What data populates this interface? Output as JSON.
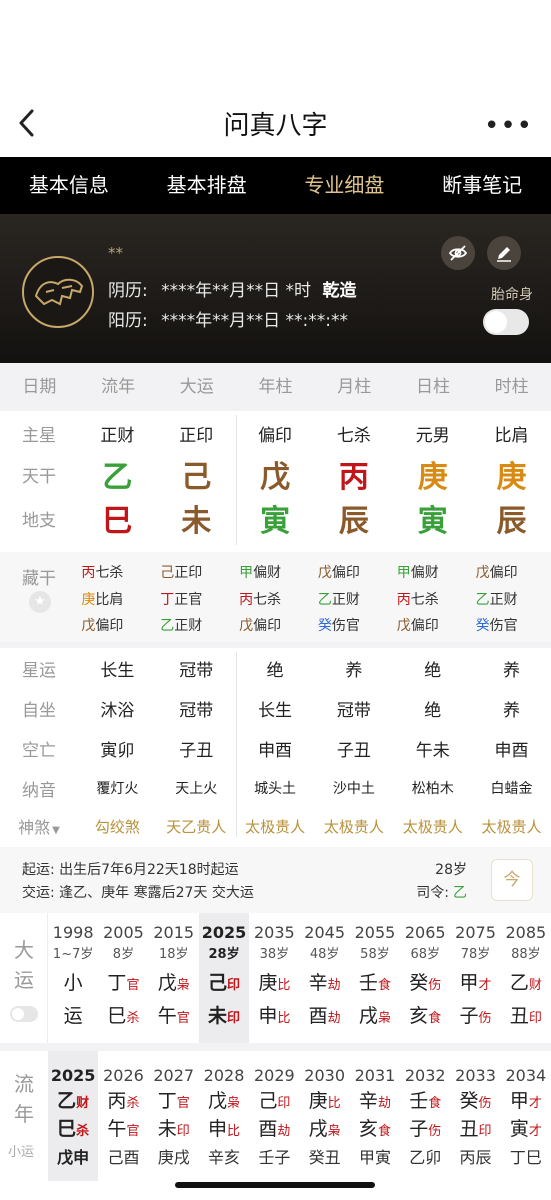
{
  "header": {
    "title": "问真八字"
  },
  "tabs": [
    "基本信息",
    "基本排盘",
    "专业细盘",
    "断事笔记"
  ],
  "banner": {
    "name": "**",
    "lunar_label": "阴历:",
    "lunar_value": "****年**月**日 *时",
    "gender": "乾造",
    "solar_label": "阳历:",
    "solar_value": "****年**月**日 **:**:**",
    "taimingshen": "胎命身"
  },
  "columns": [
    "日期",
    "流年",
    "大运",
    "年柱",
    "月柱",
    "日柱",
    "时柱"
  ],
  "rows": {
    "zhuxing": {
      "label": "主星",
      "values": [
        "正财",
        "正印",
        "偏印",
        "七杀",
        "元男",
        "比肩"
      ]
    },
    "tiangan": {
      "label": "天干",
      "values": [
        "乙",
        "己",
        "戊",
        "丙",
        "庚",
        "庚"
      ],
      "colors": [
        "#3aa03a",
        "#8a5a2b",
        "#8a5a2b",
        "#c0161a",
        "#d98a12",
        "#d98a12"
      ]
    },
    "dizhi": {
      "label": "地支",
      "values": [
        "巳",
        "未",
        "寅",
        "辰",
        "寅",
        "辰"
      ],
      "colors": [
        "#c0161a",
        "#8a5a2b",
        "#3aa03a",
        "#8a5a2b",
        "#3aa03a",
        "#8a5a2b"
      ]
    }
  },
  "canggan": {
    "label": "藏干",
    "cols": [
      [
        {
          "g": "丙",
          "c": "#c0161a",
          "t": "七杀"
        },
        {
          "g": "庚",
          "c": "#d98a12",
          "t": "比肩"
        },
        {
          "g": "戊",
          "c": "#8a5a2b",
          "t": "偏印"
        }
      ],
      [
        {
          "g": "己",
          "c": "#8a5a2b",
          "t": "正印"
        },
        {
          "g": "丁",
          "c": "#c0161a",
          "t": "正官"
        },
        {
          "g": "乙",
          "c": "#3aa03a",
          "t": "正财"
        }
      ],
      [
        {
          "g": "甲",
          "c": "#3aa03a",
          "t": "偏财"
        },
        {
          "g": "丙",
          "c": "#c0161a",
          "t": "七杀"
        },
        {
          "g": "戊",
          "c": "#8a5a2b",
          "t": "偏印"
        }
      ],
      [
        {
          "g": "戊",
          "c": "#8a5a2b",
          "t": "偏印"
        },
        {
          "g": "乙",
          "c": "#3aa03a",
          "t": "正财"
        },
        {
          "g": "癸",
          "c": "#2a6bd6",
          "t": "伤官"
        }
      ],
      [
        {
          "g": "甲",
          "c": "#3aa03a",
          "t": "偏财"
        },
        {
          "g": "丙",
          "c": "#c0161a",
          "t": "七杀"
        },
        {
          "g": "戊",
          "c": "#8a5a2b",
          "t": "偏印"
        }
      ],
      [
        {
          "g": "戊",
          "c": "#8a5a2b",
          "t": "偏印"
        },
        {
          "g": "乙",
          "c": "#3aa03a",
          "t": "正财"
        },
        {
          "g": "癸",
          "c": "#2a6bd6",
          "t": "伤官"
        }
      ]
    ]
  },
  "detail_rows": [
    {
      "label": "星运",
      "values": [
        "长生",
        "冠带",
        "绝",
        "养",
        "绝",
        "养"
      ]
    },
    {
      "label": "自坐",
      "values": [
        "沐浴",
        "冠带",
        "长生",
        "冠带",
        "绝",
        "养"
      ]
    },
    {
      "label": "空亡",
      "values": [
        "寅卯",
        "子丑",
        "申酉",
        "子丑",
        "午未",
        "申酉"
      ]
    },
    {
      "label": "纳音",
      "values": [
        "覆灯火",
        "天上火",
        "城头土",
        "沙中土",
        "松柏木",
        "白蜡金"
      ]
    }
  ],
  "shensha": {
    "label": "神煞",
    "values": [
      "勾绞煞",
      "天乙贵人",
      "太极贵人",
      "太极贵人",
      "太极贵人",
      "太极贵人"
    ],
    "color": "#b8923c"
  },
  "qiyun": {
    "line1_label": "起运:",
    "line1": "出生后7年6月22天18时起运",
    "line2_label": "交运:",
    "line2": "逢乙、庚年 寒露后27天 交大运",
    "age": "28岁",
    "siling_label": "司令:",
    "siling": "乙",
    "button": "今"
  },
  "dayun": {
    "label": [
      "大",
      "运"
    ],
    "items": [
      {
        "year": "1998",
        "age": "1~7岁",
        "g": "小",
        "z": "运",
        "gs": "",
        "zs": ""
      },
      {
        "year": "2005",
        "age": "8岁",
        "g": "丁",
        "gs": "官",
        "z": "巳",
        "zs": "杀"
      },
      {
        "year": "2015",
        "age": "18岁",
        "g": "戊",
        "gs": "枭",
        "z": "午",
        "zs": "官"
      },
      {
        "year": "2025",
        "age": "28岁",
        "g": "己",
        "gs": "印",
        "z": "未",
        "zs": "印",
        "active": true
      },
      {
        "year": "2035",
        "age": "38岁",
        "g": "庚",
        "gs": "比",
        "z": "申",
        "zs": "比"
      },
      {
        "year": "2045",
        "age": "48岁",
        "g": "辛",
        "gs": "劫",
        "z": "酉",
        "zs": "劫"
      },
      {
        "year": "2055",
        "age": "58岁",
        "g": "壬",
        "gs": "食",
        "z": "戌",
        "zs": "枭"
      },
      {
        "year": "2065",
        "age": "68岁",
        "g": "癸",
        "gs": "伤",
        "z": "亥",
        "zs": "食"
      },
      {
        "year": "2075",
        "age": "78岁",
        "g": "甲",
        "gs": "才",
        "z": "子",
        "zs": "伤"
      },
      {
        "year": "2085",
        "age": "88岁",
        "g": "乙",
        "gs": "财",
        "z": "丑",
        "zs": "印"
      }
    ]
  },
  "liunian": {
    "label": [
      "流",
      "年"
    ],
    "sublabel": "小运",
    "items": [
      {
        "year": "2025",
        "g": "乙",
        "gs": "财",
        "z": "巳",
        "zs": "杀",
        "x": "戊申",
        "active": true
      },
      {
        "year": "2026",
        "g": "丙",
        "gs": "杀",
        "z": "午",
        "zs": "官",
        "x": "己酉"
      },
      {
        "year": "2027",
        "g": "丁",
        "gs": "官",
        "z": "未",
        "zs": "印",
        "x": "庚戌"
      },
      {
        "year": "2028",
        "g": "戊",
        "gs": "枭",
        "z": "申",
        "zs": "比",
        "x": "辛亥"
      },
      {
        "year": "2029",
        "g": "己",
        "gs": "印",
        "z": "酉",
        "zs": "劫",
        "x": "壬子"
      },
      {
        "year": "2030",
        "g": "庚",
        "gs": "比",
        "z": "戌",
        "zs": "枭",
        "x": "癸丑"
      },
      {
        "year": "2031",
        "g": "辛",
        "gs": "劫",
        "z": "亥",
        "zs": "食",
        "x": "甲寅"
      },
      {
        "year": "2032",
        "g": "壬",
        "gs": "食",
        "z": "子",
        "zs": "伤",
        "x": "乙卯"
      },
      {
        "year": "2033",
        "g": "癸",
        "gs": "伤",
        "z": "丑",
        "zs": "印",
        "x": "丙辰"
      },
      {
        "year": "2034",
        "g": "甲",
        "gs": "才",
        "z": "寅",
        "zs": "才",
        "x": "丁巳"
      }
    ]
  },
  "colors": {
    "accent": "#e0c48a",
    "red": "#c0161a",
    "green": "#3aa03a",
    "brown": "#8a5a2b",
    "orange": "#d98a12",
    "blue": "#2a6bd6"
  }
}
